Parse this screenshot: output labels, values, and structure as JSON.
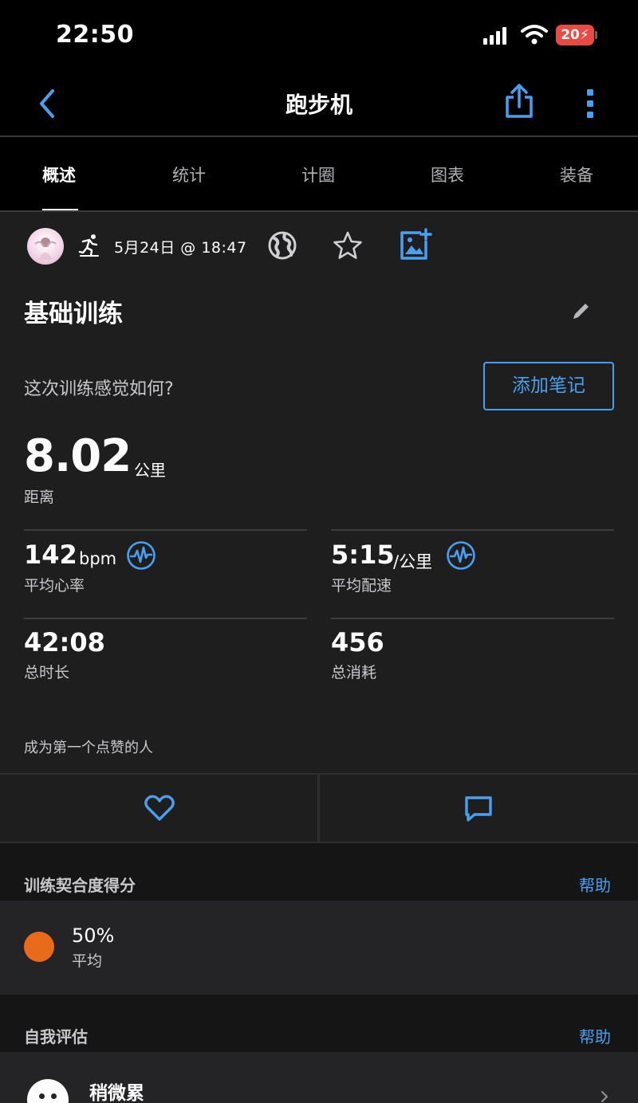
{
  "status_bar": {
    "time": "22:50",
    "battery": "20"
  },
  "nav": {
    "title": "跑步机"
  },
  "tabs": [
    {
      "label": "概述",
      "active": true
    },
    {
      "label": "统计",
      "active": false
    },
    {
      "label": "计圈",
      "active": false
    },
    {
      "label": "图表",
      "active": false
    },
    {
      "label": "装备",
      "active": false
    }
  ],
  "activity": {
    "date": "5月24日 @ 18:47",
    "title": "基础训练",
    "feel_question": "这次训练感觉如何?",
    "add_note_label": "添加笔记"
  },
  "distance": {
    "value": "8.02",
    "unit": "公里",
    "label": "距离"
  },
  "metrics": {
    "heart_rate": {
      "value": "142",
      "unit": "bpm",
      "label": "平均心率"
    },
    "pace": {
      "value": "5:15",
      "unit": "/公里",
      "label": "平均配速"
    },
    "duration": {
      "value": "42:08",
      "label": "总时长"
    },
    "calories": {
      "value": "456",
      "label": "总消耗"
    }
  },
  "social": {
    "likes_text": "成为第一个点赞的人"
  },
  "training_score": {
    "title": "训练契合度得分",
    "help": "帮助",
    "value": "50%",
    "label": "平均",
    "color": "#ea6a1c"
  },
  "self_eval": {
    "title": "自我评估",
    "help": "帮助",
    "value": "稍微累"
  },
  "colors": {
    "accent": "#4a9ff0",
    "battery": "#e84a44",
    "background": "#1e1e1f"
  },
  "icons": [
    "back-chevron-icon",
    "share-icon",
    "more-vertical-icon",
    "runner-icon",
    "globe-icon",
    "star-icon",
    "add-photo-icon",
    "edit-pencil-icon",
    "pulse-icon",
    "heart-icon",
    "comment-icon",
    "face-icon",
    "chevron-right-icon"
  ]
}
